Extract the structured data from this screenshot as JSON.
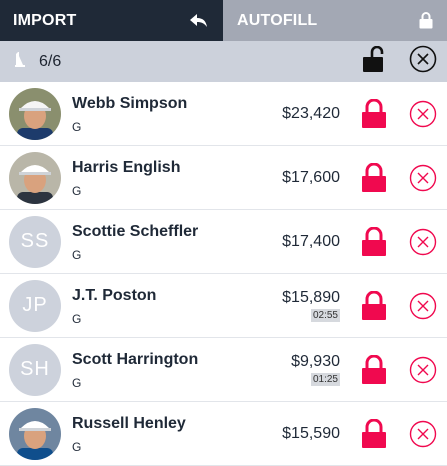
{
  "tabs": {
    "import_label": "IMPORT",
    "autofill_label": "AUTOFILL"
  },
  "lineup": {
    "count": "6/6"
  },
  "players": [
    {
      "name": "Webb Simpson",
      "position": "G",
      "salary": "$23,420",
      "time": "",
      "initials": "",
      "photo": true
    },
    {
      "name": "Harris English",
      "position": "G",
      "salary": "$17,600",
      "time": "",
      "initials": "",
      "photo": true
    },
    {
      "name": "Scottie Scheffler",
      "position": "G",
      "salary": "$17,400",
      "time": "",
      "initials": "SS",
      "photo": false
    },
    {
      "name": "J.T. Poston",
      "position": "G",
      "salary": "$15,890",
      "time": "02:55",
      "initials": "JP",
      "photo": false
    },
    {
      "name": "Scott Harrington",
      "position": "G",
      "salary": "$9,930",
      "time": "01:25",
      "initials": "SH",
      "photo": false
    },
    {
      "name": "Russell Henley",
      "position": "G",
      "salary": "$15,590",
      "time": "",
      "initials": "",
      "photo": true
    }
  ],
  "colors": {
    "lock_active": "#f0094f",
    "remove": "#f0094f",
    "header_dark": "#1f2937",
    "autofill_bg": "#a3a8b4"
  },
  "icons": {
    "import": "undo-arrow-icon",
    "autofill": "lock-icon",
    "lineup": "lineup-icon",
    "sub_lock": "unlock-icon",
    "sub_remove": "close-circle-icon",
    "row_lock": "lock-icon",
    "row_remove": "close-circle-icon"
  }
}
